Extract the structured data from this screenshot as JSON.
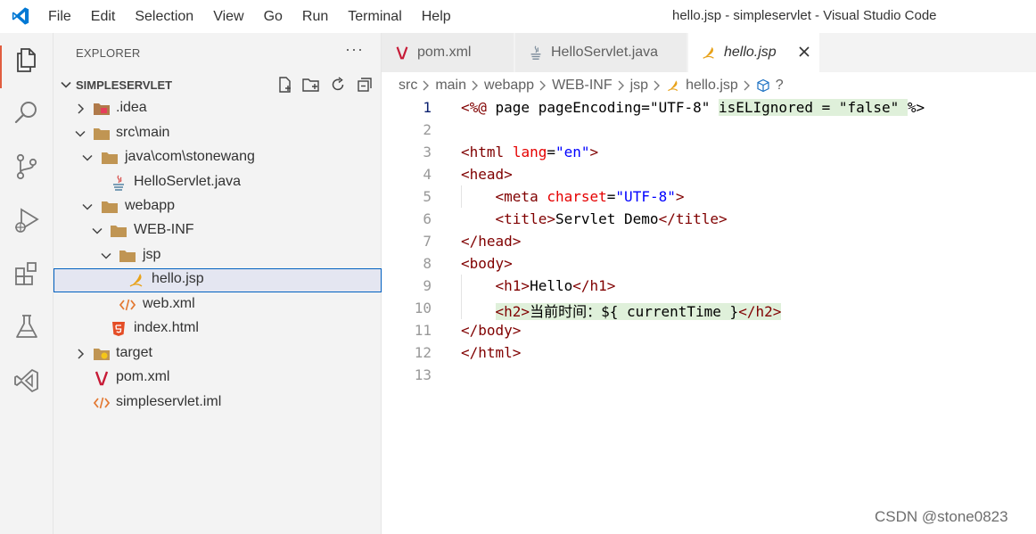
{
  "window": {
    "title": "hello.jsp - simpleservlet - Visual Studio Code"
  },
  "menu": [
    "File",
    "Edit",
    "Selection",
    "View",
    "Go",
    "Run",
    "Terminal",
    "Help"
  ],
  "explorer": {
    "header": "EXPLORER",
    "more": "···",
    "section_title": "SIMPLESERVLET",
    "tree": [
      {
        "label": ".idea",
        "kind": "folder-idea-icon",
        "expanded": false
      },
      {
        "label": "src\\main",
        "kind": "folder-icon",
        "expanded": true
      },
      {
        "label": "java\\com\\stonewang",
        "kind": "folder-icon",
        "expanded": true
      },
      {
        "label": "HelloServlet.java",
        "kind": "java-file-icon"
      },
      {
        "label": "webapp",
        "kind": "folder-icon",
        "expanded": true
      },
      {
        "label": "WEB-INF",
        "kind": "folder-icon",
        "expanded": true
      },
      {
        "label": "jsp",
        "kind": "folder-icon",
        "expanded": true
      },
      {
        "label": "hello.jsp",
        "kind": "jsp-file-icon",
        "selected": true
      },
      {
        "label": "web.xml",
        "kind": "xml-file-icon"
      },
      {
        "label": "index.html",
        "kind": "html5-file-icon"
      },
      {
        "label": "target",
        "kind": "folder-target-icon",
        "expanded": false
      },
      {
        "label": "pom.xml",
        "kind": "maven-file-icon"
      },
      {
        "label": "simpleservlet.iml",
        "kind": "xml-file-icon"
      }
    ]
  },
  "tabs": [
    {
      "label": "pom.xml",
      "icon": "maven-file-icon",
      "active": false
    },
    {
      "label": "HelloServlet.java",
      "icon": "java-file-icon",
      "active": false
    },
    {
      "label": "hello.jsp",
      "icon": "jsp-file-icon",
      "active": true,
      "close": "✕"
    }
  ],
  "breadcrumb": [
    "src",
    "main",
    "webapp",
    "WEB-INF",
    "jsp",
    "hello.jsp",
    "?"
  ],
  "editor": {
    "line_numbers": [
      "1",
      "2",
      "3",
      "4",
      "5",
      "6",
      "7",
      "8",
      "9",
      "10",
      "11",
      "12",
      "13"
    ],
    "lines": [
      "<%@ page pageEncoding=\"UTF-8\" isELIgnored = \"false\" %>",
      "",
      "<html lang=\"en\">",
      "<head>",
      "    <meta charset=\"UTF-8\">",
      "    <title>Servlet Demo</title>",
      "</head>",
      "<body>",
      "    <h1>Hello</h1>",
      "    <h2>当前时间：${ currentTime }</h2>",
      "</body>",
      "</html>",
      ""
    ]
  },
  "watermark": "CSDN @stone0823",
  "colors": {
    "accent_orange": "#e05d3f",
    "selection_border": "#0060c0",
    "tag": "#800000",
    "attr": "#e50000",
    "string": "#0000ff",
    "highlight": "#dff0da"
  }
}
